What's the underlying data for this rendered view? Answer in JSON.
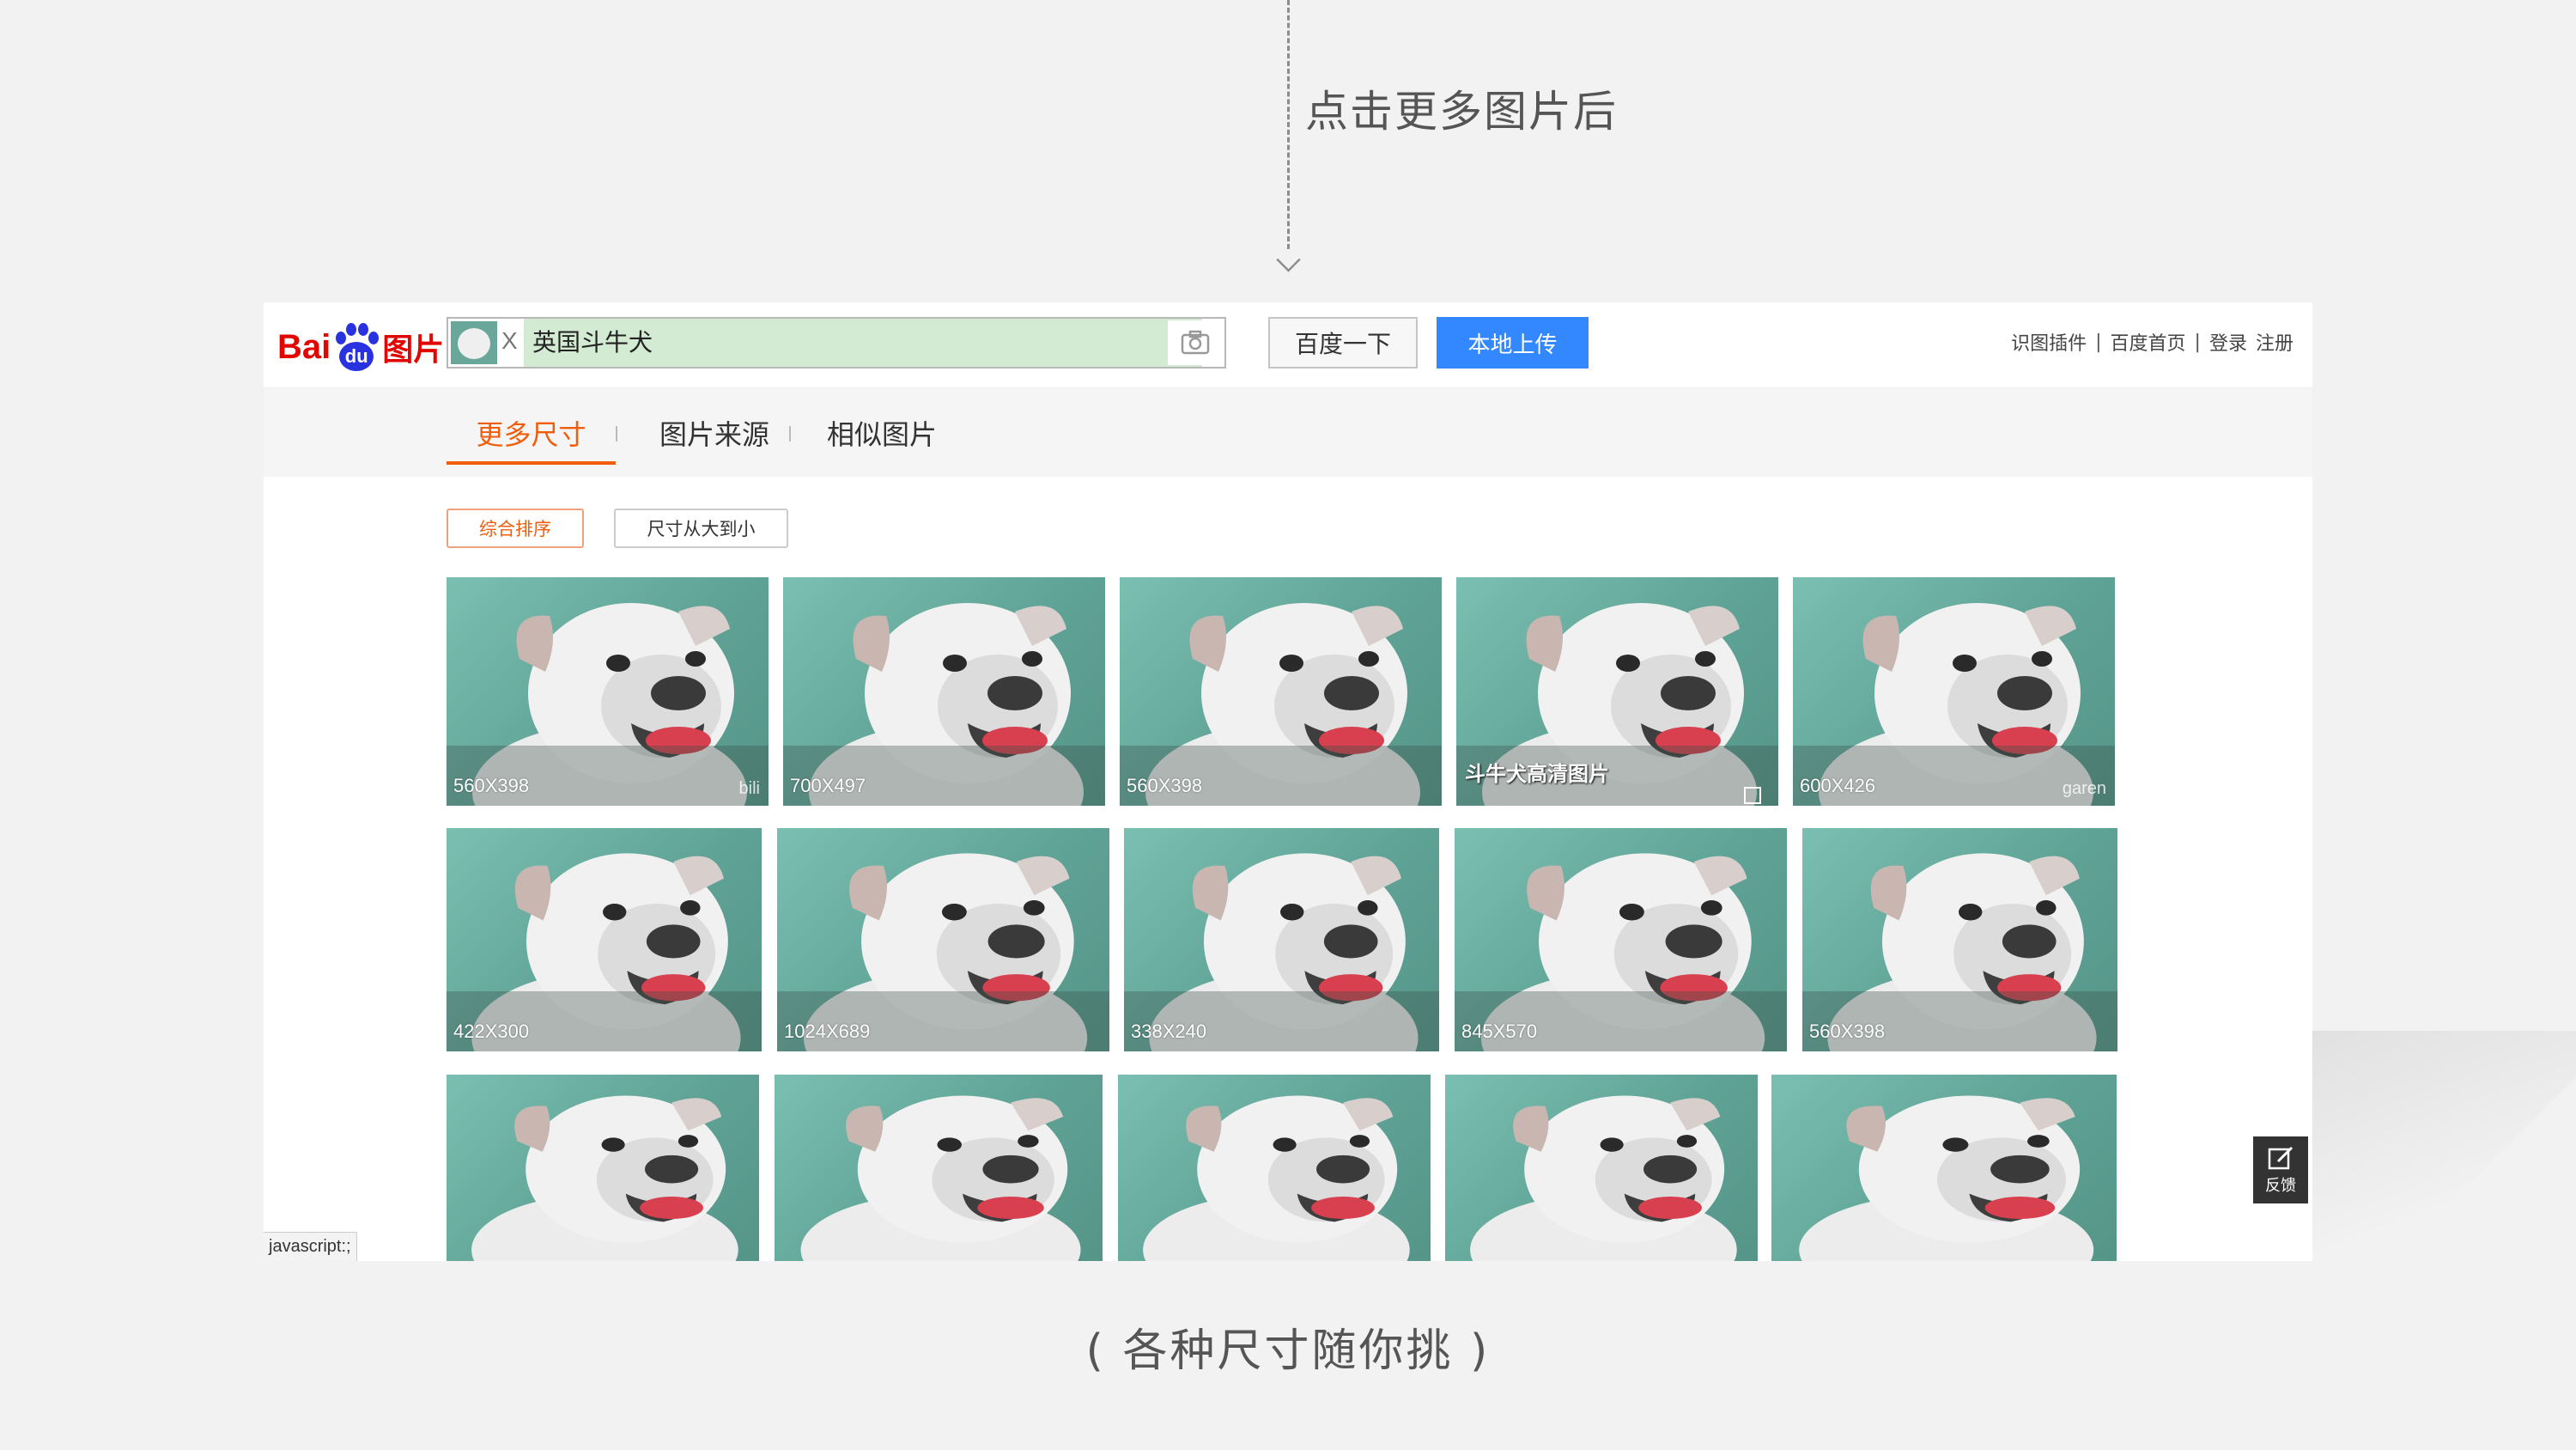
{
  "annotation": {
    "top_caption": "点击更多图片后",
    "bottom_caption": "( 各种尺寸随你挑 )"
  },
  "header": {
    "logo_text_bai": "Bai",
    "logo_text_du": "du",
    "logo_text_pic": "图片",
    "chip_close": "X",
    "query": "英国斗牛犬",
    "search_button": "百度一下",
    "upload_button": "本地上传",
    "links": [
      "识图插件",
      "百度首页",
      "登录",
      "注册"
    ]
  },
  "tabs": [
    {
      "label": "更多尺寸",
      "active": true
    },
    {
      "label": "图片来源",
      "active": false
    },
    {
      "label": "相似图片",
      "active": false
    }
  ],
  "sort": {
    "default": "综合排序",
    "by_size": "尺寸从大到小"
  },
  "images_row1": [
    {
      "size": "560X398",
      "watermark": "bili"
    },
    {
      "size": "700X497",
      "watermark": ""
    },
    {
      "size": "560X398",
      "watermark": ""
    },
    {
      "size": "",
      "watermark": "",
      "overlay": "斗牛犬高清图片"
    },
    {
      "size": "600X426",
      "watermark": "garen"
    }
  ],
  "images_row2": [
    {
      "size": "422X300",
      "watermark": ""
    },
    {
      "size": "1024X689",
      "watermark": ""
    },
    {
      "size": "338X240",
      "watermark": ""
    },
    {
      "size": "845X570",
      "watermark": ""
    },
    {
      "size": "560X398",
      "watermark": ""
    }
  ],
  "images_row3": [
    {
      "size": ""
    },
    {
      "size": ""
    },
    {
      "size": ""
    },
    {
      "size": ""
    },
    {
      "size": ""
    }
  ],
  "status_hint": "javascript:;",
  "feedback_label": "反馈",
  "colors": {
    "brand_red": "#e10602",
    "brand_blue": "#2932e1",
    "accent_orange": "#f25d0c",
    "upload_blue": "#3388ff",
    "query_bg": "#d3ebd3"
  }
}
